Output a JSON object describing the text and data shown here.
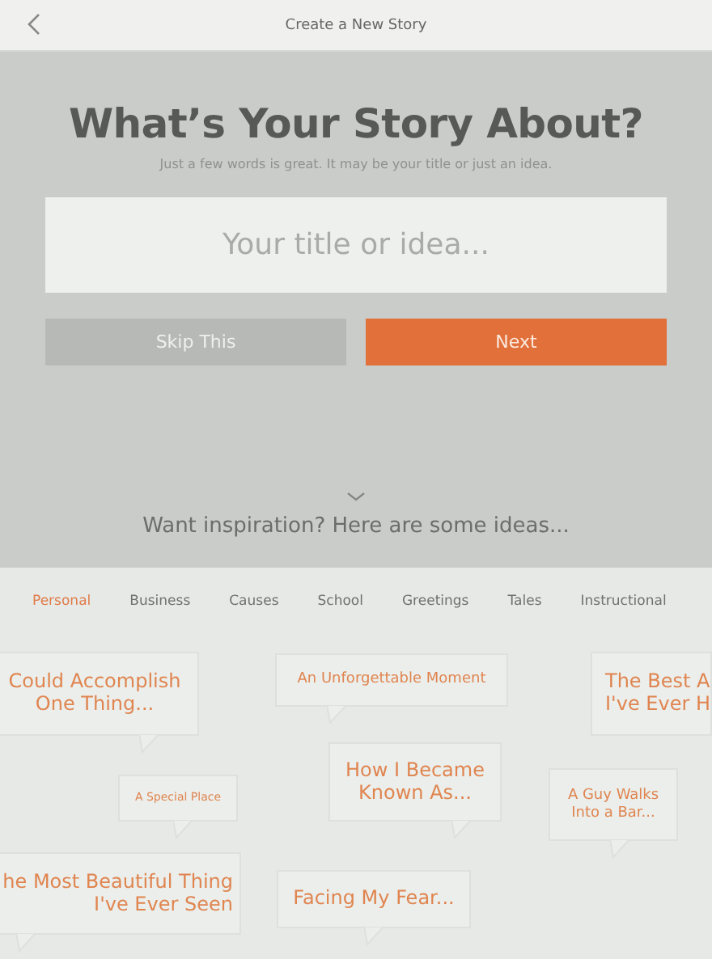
{
  "window": {
    "title": "Create a New Story"
  },
  "heading": "What’s Your Story About?",
  "subtitle": "Just a few words is great. It may be your title or just an idea.",
  "title_field": {
    "placeholder": "Your title or idea..."
  },
  "buttons": [
    {
      "label": "Skip This",
      "kind": "secondary"
    },
    {
      "label": "Next",
      "kind": "primary"
    }
  ],
  "inspiration": "Want inspiration? Here are some ideas...",
  "tabs": [
    {
      "label": "Personal",
      "selected": true
    },
    {
      "label": "Business",
      "selected": false
    },
    {
      "label": "Causes",
      "selected": false
    },
    {
      "label": "School",
      "selected": false
    },
    {
      "label": "Greetings",
      "selected": false
    },
    {
      "label": "Tales",
      "selected": false
    },
    {
      "label": "Instructional",
      "selected": false
    }
  ],
  "ideas": [
    "Could Accomplish\nOne Thing...",
    "An Unforgettable Moment",
    "The Best A\nI've Ever H",
    "A Special Place",
    "How I Became\nKnown As...",
    "A Guy Walks\nInto a Bar...",
    "he Most Beautiful Thing\nI've Ever Seen",
    "Facing My Fear..."
  ]
}
